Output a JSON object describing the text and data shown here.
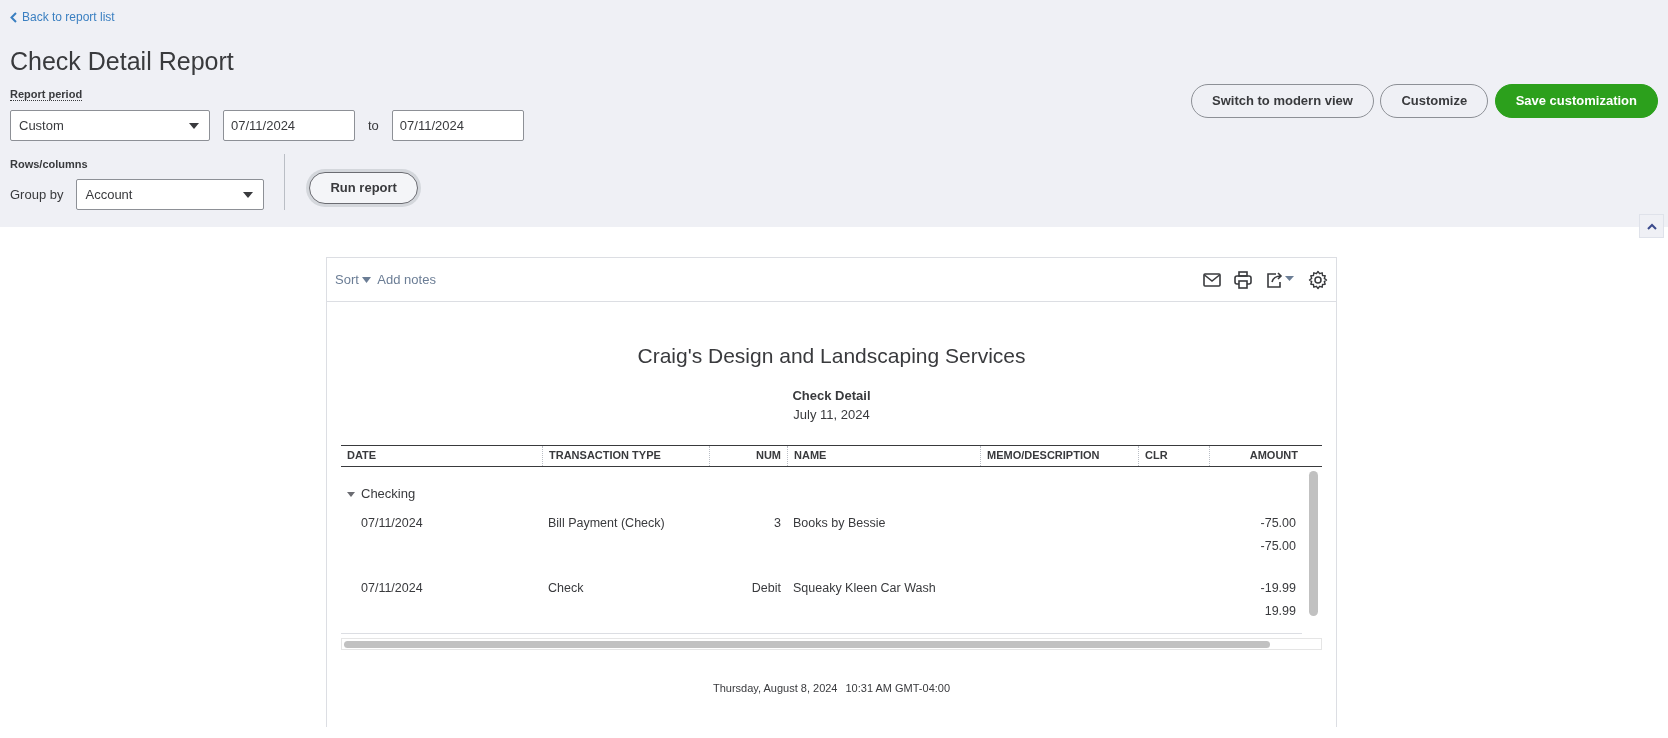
{
  "header": {
    "back_link": "Back to report list",
    "title": "Check Detail Report",
    "report_period": {
      "label": "Report period",
      "preset": "Custom",
      "from": "07/11/2024",
      "to_label": "to",
      "to": "07/11/2024"
    },
    "rows_columns": {
      "label": "Rows/columns",
      "group_by_label": "Group by",
      "group_by": "Account"
    },
    "run_button": "Run report",
    "buttons": [
      {
        "label": "Switch to modern view",
        "kind": "outline"
      },
      {
        "label": "Customize",
        "kind": "outline"
      },
      {
        "label": "Save customization",
        "kind": "primary"
      }
    ]
  },
  "report": {
    "toolbar": {
      "sort": "Sort",
      "add_notes": "Add notes"
    },
    "company": "Craig's Design and Landscaping Services",
    "title": "Check Detail",
    "period": "July 11, 2024",
    "columns": [
      {
        "label": "DATE"
      },
      {
        "label": "TRANSACTION TYPE"
      },
      {
        "label": "NUM"
      },
      {
        "label": "NAME"
      },
      {
        "label": "MEMO/DESCRIPTION"
      },
      {
        "label": "CLR"
      },
      {
        "label": "AMOUNT"
      }
    ],
    "groups": [
      {
        "name": "Checking",
        "expanded": true,
        "rows": [
          {
            "kind": "transaction",
            "date": "07/11/2024",
            "type": "Bill Payment (Check)",
            "num": "3",
            "name": "Books by Bessie",
            "amount": "-75.00"
          },
          {
            "kind": "total",
            "amount": "-75.00"
          },
          {
            "kind": "transaction",
            "date": "07/11/2024",
            "type": "Check",
            "num": "Debit",
            "name": "Squeaky Kleen Car Wash",
            "amount": "-19.99"
          },
          {
            "kind": "total",
            "amount": "19.99"
          }
        ]
      }
    ],
    "footer_date": "Thursday, August 8, 2024",
    "footer_time": "10:31 AM GMT-04:00"
  }
}
